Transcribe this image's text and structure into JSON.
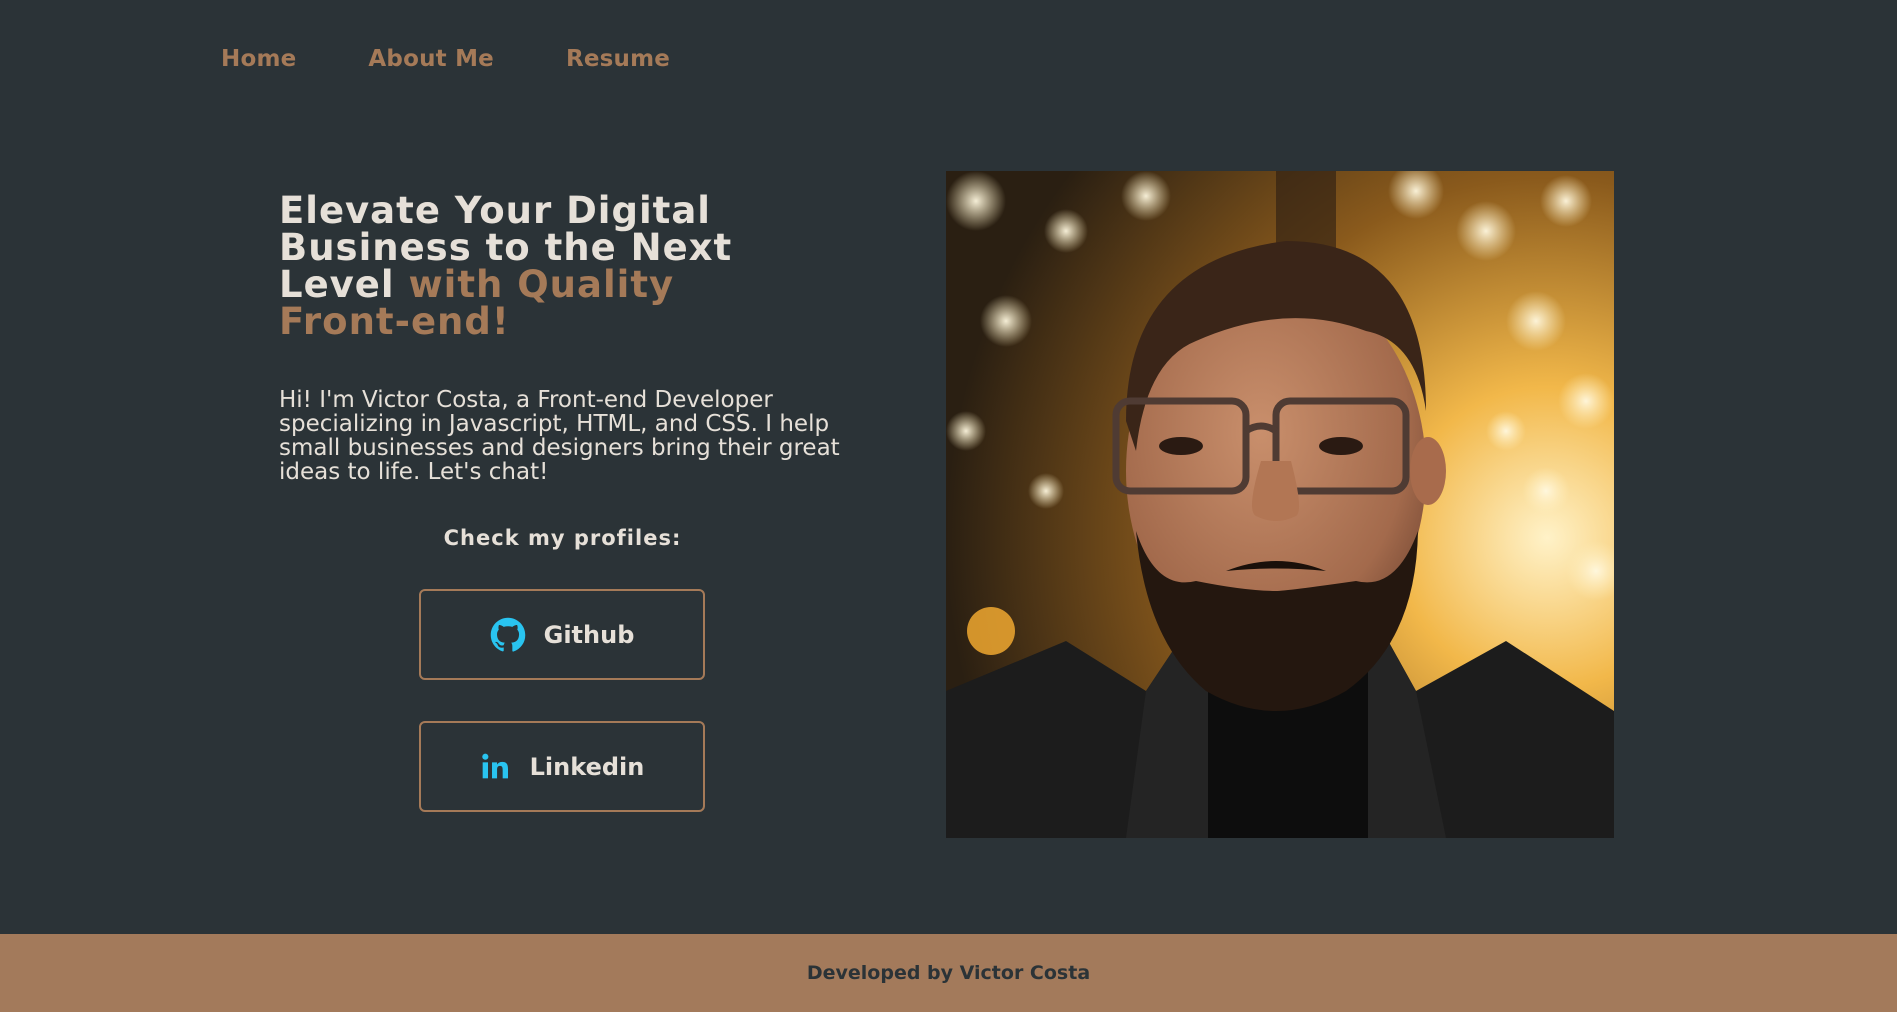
{
  "nav": {
    "items": [
      {
        "label": "Home"
      },
      {
        "label": "About Me"
      },
      {
        "label": "Resume"
      }
    ]
  },
  "hero": {
    "headline_main": "Elevate Your Digital Business to the Next Level ",
    "headline_accent": "with Quality Front-end!",
    "intro": "Hi! I'm Victor Costa, a Front-end Developer specializing in Javascript, HTML, and CSS. I help small businesses and designers bring their great ideas to life. Let's chat!",
    "profiles_label": "Check my profiles:",
    "profiles": [
      {
        "label": "Github",
        "icon": "github-icon"
      },
      {
        "label": "Linkedin",
        "icon": "linkedin-icon"
      }
    ]
  },
  "photo": {
    "subject": "portrait-photo"
  },
  "footer": {
    "text": "Developed by Victor Costa"
  },
  "colors": {
    "background": "#2b3337",
    "accent": "#a57a58",
    "text": "#e6e0d8",
    "icon": "#29c4f0",
    "footer": "#a37a5b"
  }
}
